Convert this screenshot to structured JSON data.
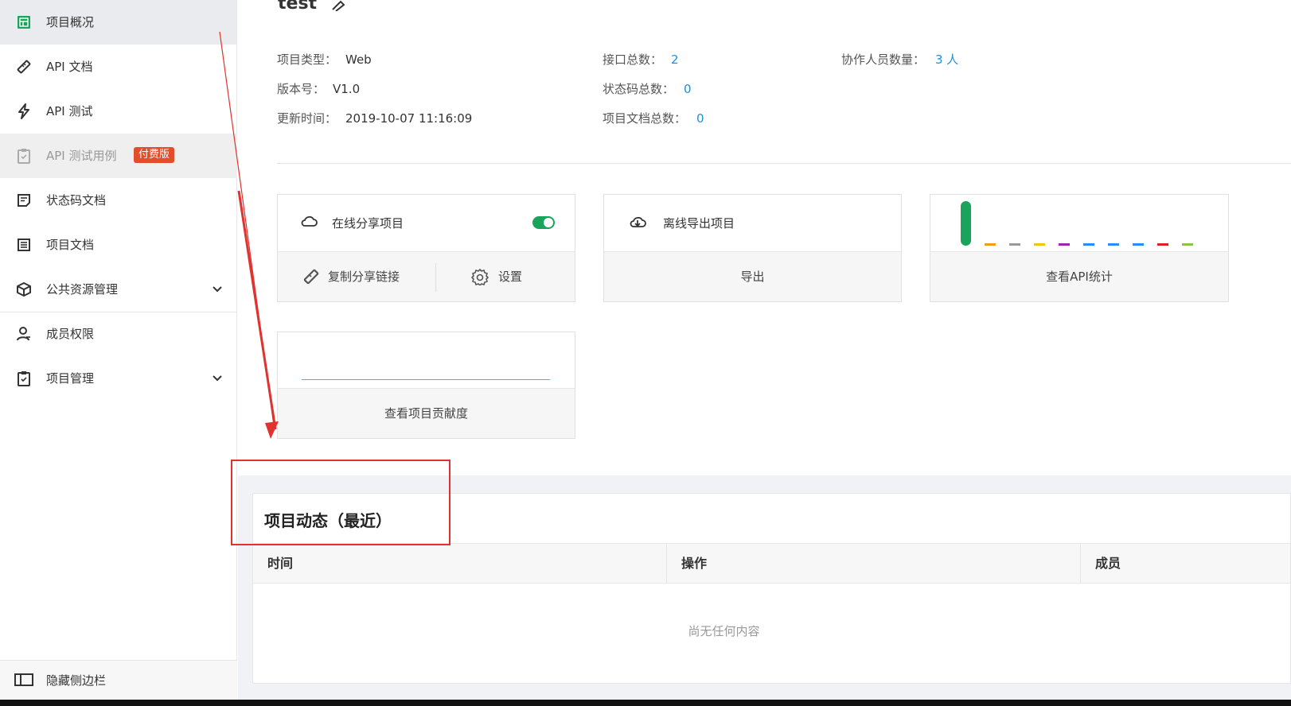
{
  "sidebar": {
    "items": [
      {
        "label": "项目概况"
      },
      {
        "label": "API 文档"
      },
      {
        "label": "API 测试"
      },
      {
        "label": "API 测试用例",
        "badge": "付费版"
      },
      {
        "label": "状态码文档"
      },
      {
        "label": "项目文档"
      },
      {
        "label": "公共资源管理"
      },
      {
        "label": "成员权限"
      },
      {
        "label": "项目管理"
      }
    ],
    "footer": "隐藏侧边栏"
  },
  "project": {
    "name": "test",
    "type_label": "项目类型：",
    "type_value": "Web",
    "version_label": "版本号：",
    "version_value": "V1.0",
    "updated_label": "更新时间：",
    "updated_value": "2019-10-07 11:16:09",
    "api_total_label": "接口总数：",
    "api_total_value": "2",
    "status_total_label": "状态码总数：",
    "status_total_value": "0",
    "doc_total_label": "项目文档总数：",
    "doc_total_value": "0",
    "members_label": "协作人员数量：",
    "members_value": "3 人"
  },
  "cards": {
    "share": {
      "title": "在线分享项目",
      "copy_link": "复制分享链接",
      "settings": "设置",
      "enabled": true
    },
    "export": {
      "title": "离线导出项目",
      "button": "导出"
    },
    "api_stats": {
      "button": "查看API统计"
    },
    "contribution": {
      "button": "查看项目贡献度"
    }
  },
  "chart_data": {
    "type": "bar",
    "series_colors": [
      "#19a45b",
      "#f39c12",
      "#999999",
      "#f1c40f",
      "#9b27b0",
      "#1e90ff",
      "#1e90ff",
      "#1e90ff",
      "#e02020",
      "#8bc34a"
    ]
  },
  "activity": {
    "title": "项目动态（最近）",
    "columns": [
      "时间",
      "操作",
      "成员"
    ],
    "empty_text": "尚无任何内容"
  },
  "colors": {
    "accent": "#19a45b",
    "link": "#1e90d8",
    "badge": "#e04e2b",
    "annotation": "#e0322e"
  }
}
